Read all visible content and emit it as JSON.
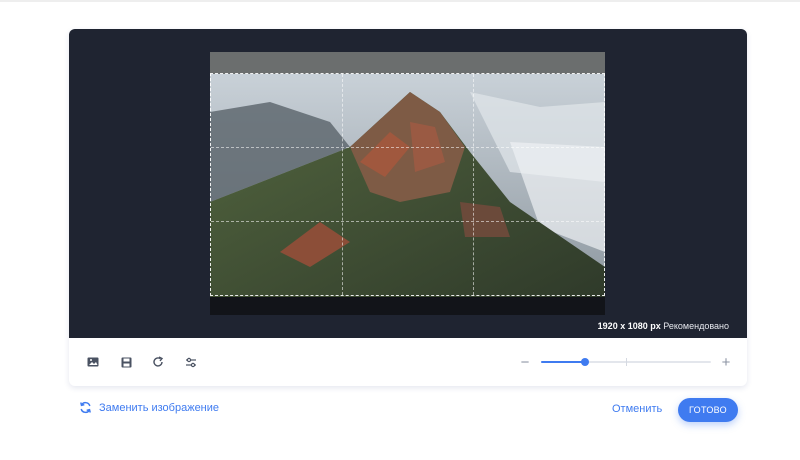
{
  "canvas": {
    "background_color": "#1f2431",
    "resolution_size": "1920 x 1080 px",
    "resolution_note": "Рекомендовано"
  },
  "image": {
    "description_icon": "image-preview",
    "crop_grid": "thirds"
  },
  "toolbar": {
    "tools": [
      {
        "icon": "image-icon",
        "name": "image"
      },
      {
        "icon": "save-icon",
        "name": "save"
      },
      {
        "icon": "rotate-icon",
        "name": "rotate"
      },
      {
        "icon": "adjust-icon",
        "name": "adjust"
      }
    ],
    "zoom": {
      "minus_label": "−",
      "plus_label": "+",
      "value": 0.26,
      "accent_color": "#3f7bf0"
    }
  },
  "footer": {
    "replace_label": "Заменить изображение",
    "replace_icon": "refresh-icon",
    "cancel_label": "Отменить",
    "done_label": "ГОТОВО",
    "accent_color": "#3f7bf0"
  }
}
